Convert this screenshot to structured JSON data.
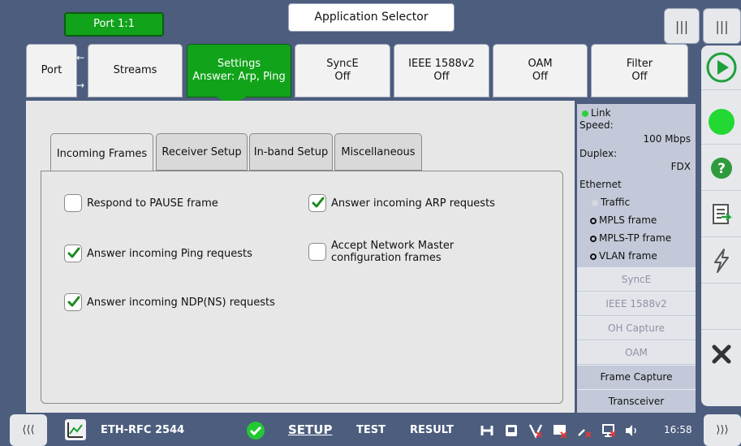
{
  "header": {
    "port_label": "Port 1:1",
    "app_selector_label": "Application Selector"
  },
  "tabs": [
    {
      "line1": "Port",
      "line2": ""
    },
    {
      "line1": "Streams",
      "line2": ""
    },
    {
      "line1": "Settings",
      "line2": "Answer: Arp, Ping"
    },
    {
      "line1": "SyncE",
      "line2": "Off"
    },
    {
      "line1": "IEEE 1588v2",
      "line2": "Off"
    },
    {
      "line1": "OAM",
      "line2": "Off"
    },
    {
      "line1": "Filter",
      "line2": "Off"
    }
  ],
  "subtabs": [
    "Incoming Frames",
    "Receiver Setup",
    "In-band Setup",
    "Miscellaneous"
  ],
  "options": {
    "respond_pause": {
      "label": "Respond to PAUSE frame",
      "checked": false
    },
    "answer_arp": {
      "label": "Answer incoming ARP requests",
      "checked": true
    },
    "answer_ping": {
      "label": "Answer incoming Ping requests",
      "checked": true
    },
    "accept_nm_line1": "Accept Network Master",
    "accept_nm_line2": "configuration frames",
    "accept_nm_checked": false,
    "answer_ndp": {
      "label": "Answer incoming NDP(NS) requests",
      "checked": true
    }
  },
  "status": {
    "link": "Link",
    "speed_label": "Speed:",
    "speed_value": "100 Mbps",
    "duplex_label": "Duplex:",
    "duplex_value": "FDX",
    "ethernet_label": "Ethernet",
    "traffic": "Traffic",
    "mpls": "MPLS frame",
    "mpls_tp": "MPLS-TP frame",
    "vlan": "VLAN frame",
    "buttons": [
      "SyncE",
      "IEEE 1588v2",
      "OH Capture",
      "OAM",
      "Frame Capture",
      "Transceiver"
    ]
  },
  "bottom": {
    "test_name": "ETH-RFC 2544",
    "setup": "SETUP",
    "test": "TEST",
    "result": "RESULT",
    "time": "16:58"
  },
  "colors": {
    "accent_green": "#11a31a",
    "frame_blue": "#4c5d7e",
    "status_panel": "#c3c9d8"
  }
}
